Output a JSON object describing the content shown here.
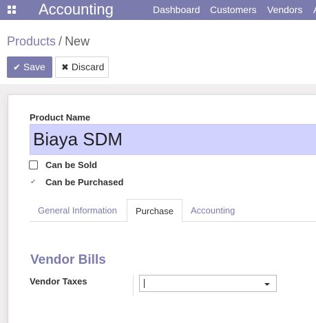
{
  "navbar": {
    "app_title": "Accounting",
    "menu": [
      "Dashboard",
      "Customers",
      "Vendors",
      "A"
    ],
    "apps_icon": "grid-icon",
    "color": "#7c7bad"
  },
  "breadcrumb": {
    "parent": "Products",
    "separator": "/",
    "current": "New"
  },
  "toolbar": {
    "save_label": "Save",
    "save_icon": "✔",
    "discard_label": "Discard",
    "discard_icon": "✖"
  },
  "form": {
    "name_label": "Product Name",
    "name_value": "Biaya SDM",
    "can_be_sold": {
      "label": "Can be Sold",
      "checked": false
    },
    "can_be_purchased": {
      "label": "Can be Purchased",
      "checked": true
    },
    "tabs": [
      {
        "label": "General Information",
        "active": false
      },
      {
        "label": "Purchase",
        "active": true
      },
      {
        "label": "Accounting",
        "active": false
      }
    ],
    "section_title": "Vendor Bills",
    "vendor_taxes_label": "Vendor Taxes",
    "vendor_taxes_value": ""
  }
}
